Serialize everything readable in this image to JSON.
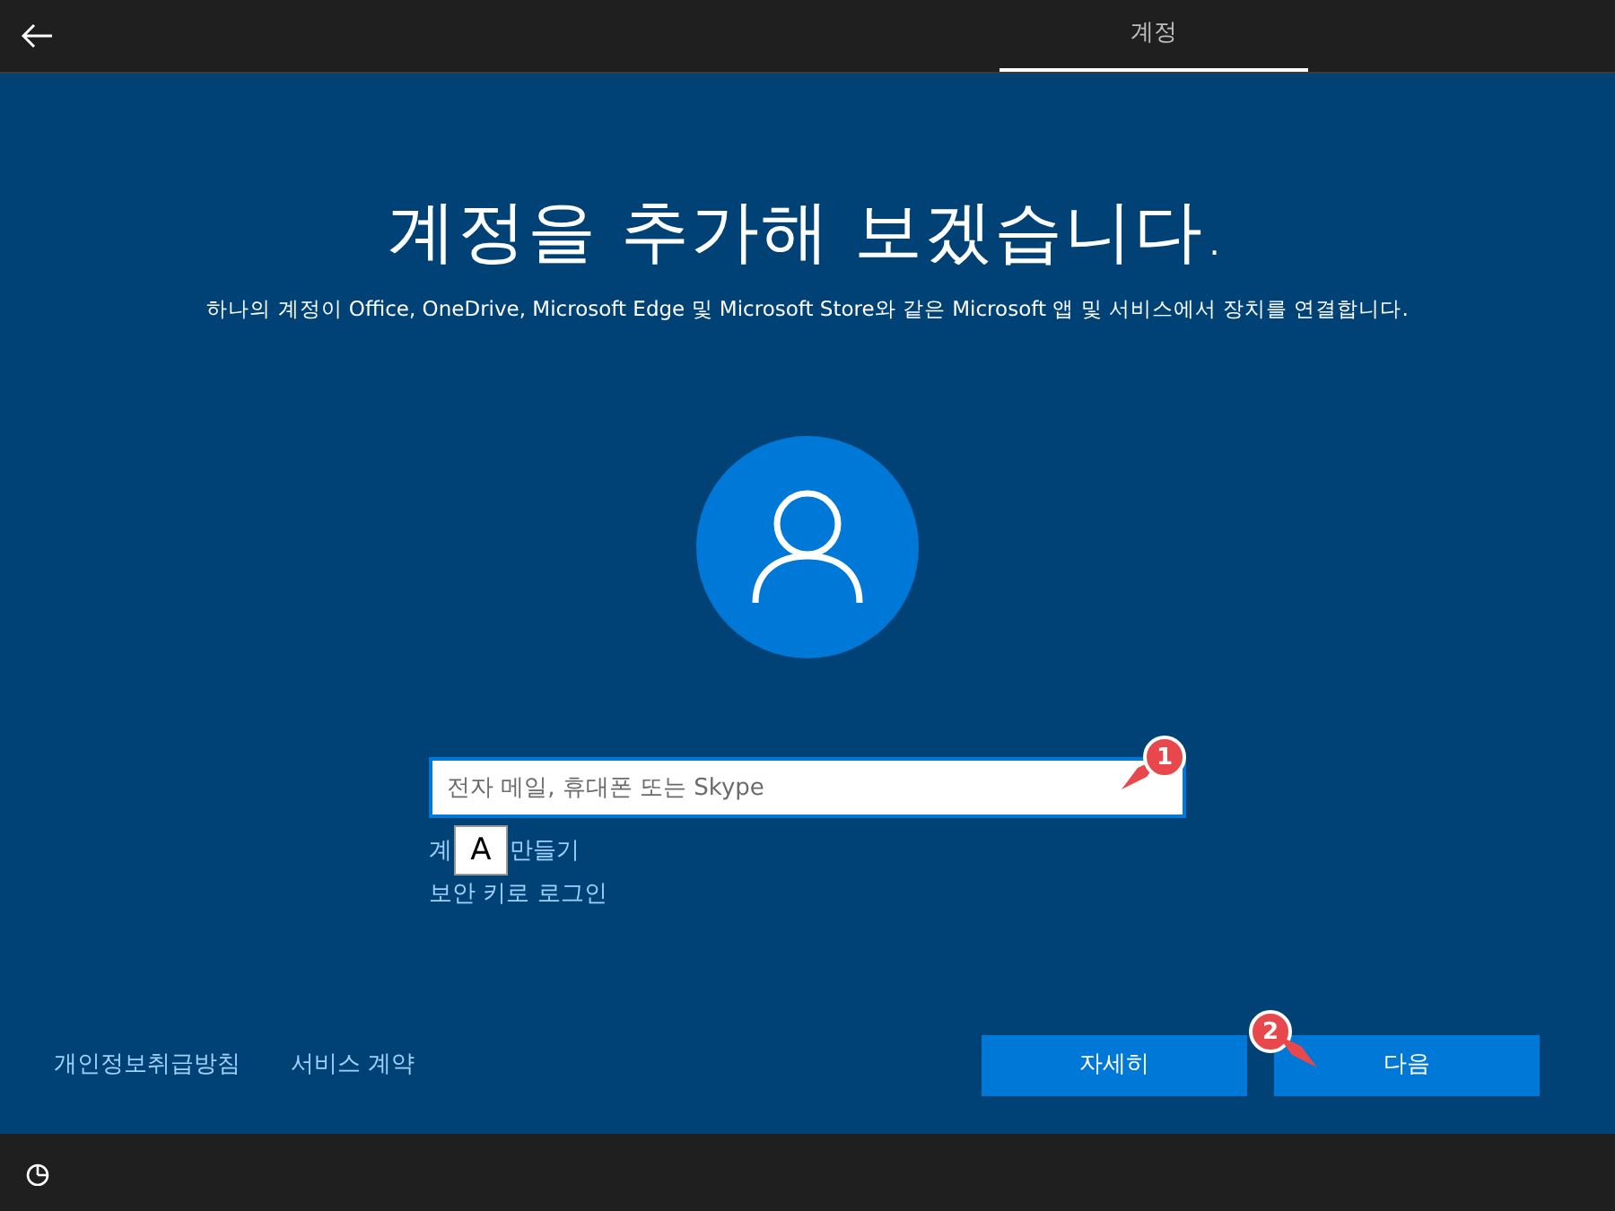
{
  "header": {
    "tabs": [
      {
        "label": "계정",
        "selected": true
      }
    ]
  },
  "title": "계정을 추가해 보겠습니다.",
  "subtitle": "하나의 계정이 Office, OneDrive, Microsoft Edge 및 Microsoft Store와 같은 Microsoft 앱 및 서비스에서 장치를 연결합니다.",
  "account_field": {
    "placeholder": "전자 메일, 휴대폰 또는 Skype"
  },
  "create_account_link": {
    "text_before": "계",
    "text_after": "만들기"
  },
  "ime_indicator": "A",
  "security_key_link": "보안 키로 로그인",
  "footer_links": [
    "개인정보취급방침",
    "서비스 계약"
  ],
  "buttons": [
    "자세히",
    "다음"
  ],
  "callouts": [
    "1",
    "2"
  ]
}
